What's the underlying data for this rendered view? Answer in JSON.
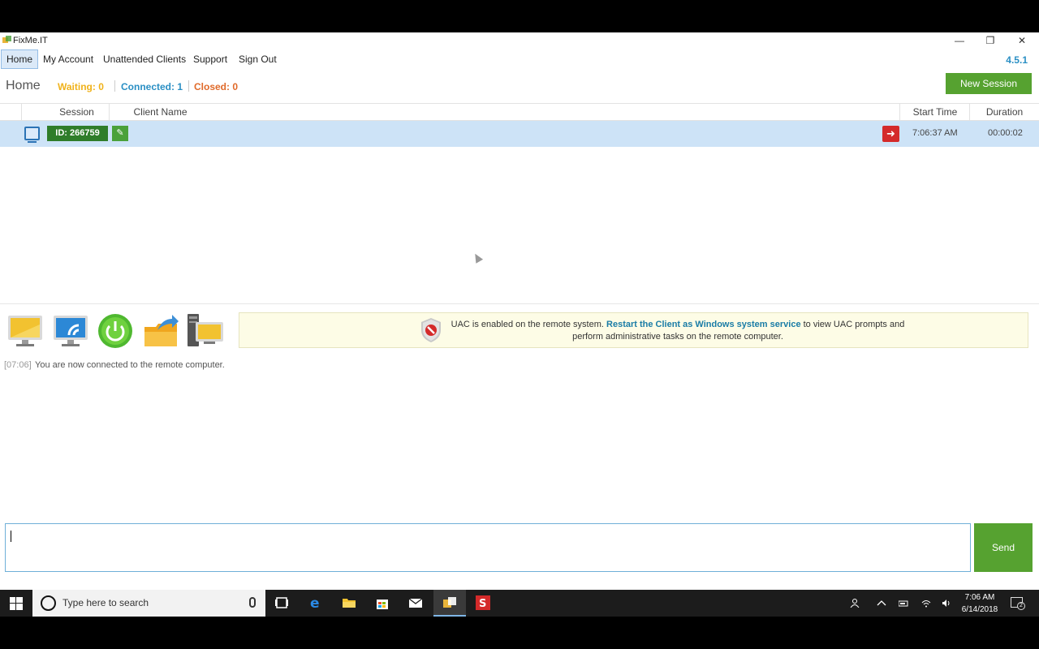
{
  "window": {
    "title": "FixMe.IT",
    "minimize_glyph": "—",
    "restore_glyph": "❐",
    "close_glyph": "✕"
  },
  "menu": {
    "items": [
      {
        "label": "Home",
        "name": "menu-home"
      },
      {
        "label": "My Account",
        "name": "menu-my-account"
      },
      {
        "label": "Unattended Clients",
        "name": "menu-unattended-clients"
      },
      {
        "label": "Support",
        "name": "menu-support"
      },
      {
        "label": "Sign Out",
        "name": "menu-sign-out"
      }
    ],
    "version": "4.5.1"
  },
  "header": {
    "title": "Home",
    "waiting": "Waiting: 0",
    "connected": "Connected: 1",
    "closed": "Closed: 0",
    "new_session": "New Session"
  },
  "colors": {
    "waiting": "#f0b21a",
    "connected": "#2a8fc4",
    "closed": "#e06a2a",
    "accent_green": "#56a230"
  },
  "table": {
    "columns": {
      "session": "Session",
      "client_name": "Client Name",
      "start_time": "Start Time",
      "duration": "Duration"
    },
    "rows": [
      {
        "id": "ID: 266759",
        "client_name": "",
        "start_time": "7:06:37 AM",
        "duration": "00:00:02"
      }
    ]
  },
  "tools": [
    {
      "name": "remote-desktop-tool-icon"
    },
    {
      "name": "remote-network-tool-icon"
    },
    {
      "name": "power-reboot-tool-icon"
    },
    {
      "name": "file-transfer-tool-icon"
    },
    {
      "name": "system-info-tool-icon"
    }
  ],
  "uac_banner": {
    "text_before": "UAC is enabled on the remote system. ",
    "link": "Restart the Client as Windows system service",
    "text_after": " to view UAC prompts and perform administrative tasks on the remote computer."
  },
  "chat": {
    "messages": [
      {
        "time": "[07:06]",
        "text": "You are now connected to the remote computer."
      }
    ],
    "input_value": "",
    "send_label": "Send"
  },
  "taskbar": {
    "search_placeholder": "Type here to search",
    "clock_time": "7:06 AM",
    "clock_date": "6/14/2018",
    "notification_count": "2"
  }
}
